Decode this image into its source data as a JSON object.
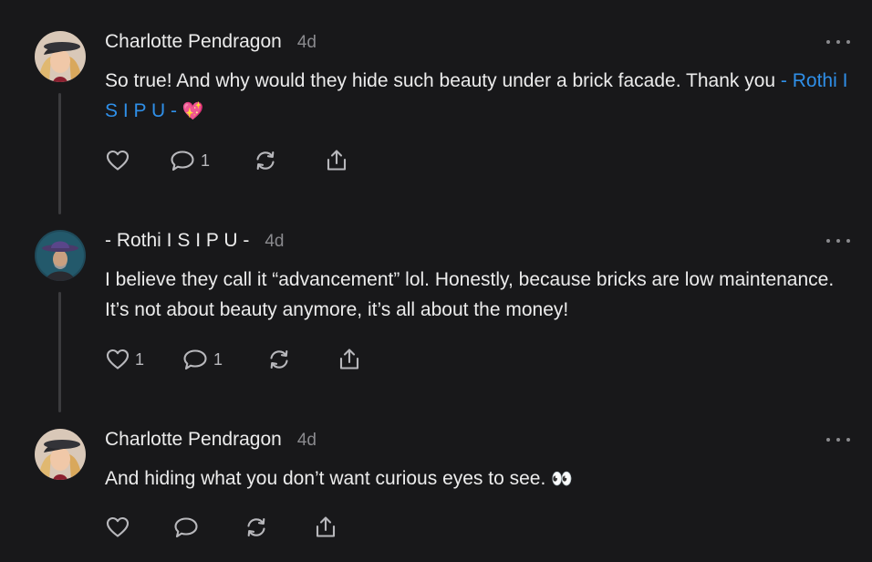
{
  "comments": [
    {
      "author": "Charlotte Pendragon",
      "time": "4d",
      "text": "So true! And why would they hide such beauty under a brick facade. Thank you ",
      "mention": "- Rothi I S I P U -",
      "emoji": "💖",
      "likes": "",
      "replies": "1"
    },
    {
      "author": "- Rothi I S I P U -",
      "time": "4d",
      "text": "I believe they call it “advancement” lol. Honestly, because bricks are low maintenance. It’s not about beauty anymore, it’s all about the money!",
      "likes": "1",
      "replies": "1"
    },
    {
      "author": "Charlotte Pendragon",
      "time": "4d",
      "text": "And hiding what you don’t want curious eyes to see. ",
      "emoji": "👀",
      "likes": "",
      "replies": ""
    }
  ],
  "icons": {
    "like": "heart-icon",
    "reply": "speech-bubble-icon",
    "restack": "restack-arrows-icon",
    "share": "share-upload-icon",
    "more": "more-dots-icon"
  },
  "colors": {
    "background": "#18181a",
    "text": "#ececec",
    "muted": "#8a8a8e",
    "mention": "#2f8fe8",
    "thread_line": "#3b3b3e"
  }
}
